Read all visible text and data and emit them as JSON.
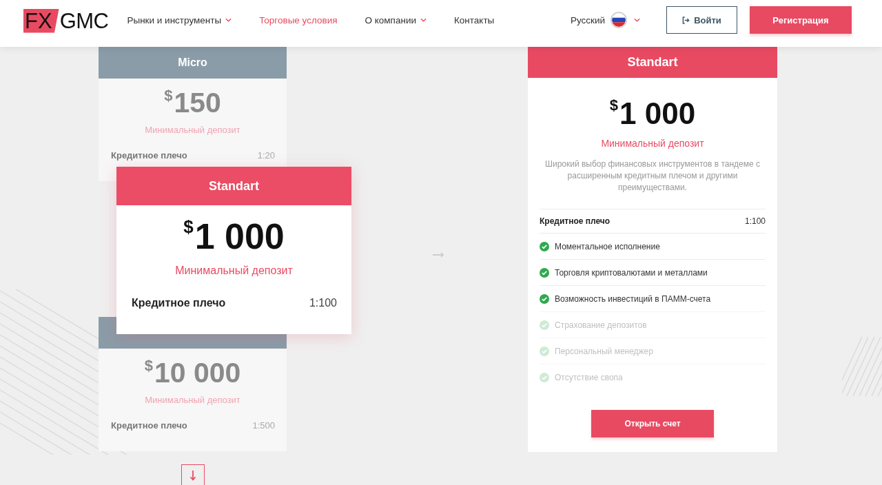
{
  "header": {
    "logo": {
      "highlight": "FX",
      "text": "GMC"
    },
    "nav": [
      {
        "label": "Рынки и инструменты",
        "dropdown": true,
        "selected": false
      },
      {
        "label": "Торговые условия",
        "dropdown": false,
        "selected": true
      },
      {
        "label": "О компании",
        "dropdown": true,
        "selected": false
      },
      {
        "label": "Контакты",
        "dropdown": false,
        "selected": false
      }
    ],
    "language": {
      "label": "Русский"
    },
    "login_button": {
      "label": "Войти"
    },
    "register_button": {
      "label": "Регистрация"
    }
  },
  "account_carousel": {
    "cards": [
      {
        "name": "Micro",
        "currency": "$",
        "price": "150",
        "deposit_label": "Минимальный депозит",
        "leverage_label": "Кредитное плечо",
        "leverage": "1:20",
        "selected": false
      },
      {
        "name": "Standart",
        "currency": "$",
        "price": "1 000",
        "deposit_label": "Минимальный депозит",
        "leverage_label": "Кредитное плечо",
        "leverage": "1:100",
        "selected": true
      },
      {
        "currency": "$",
        "price": "10 000",
        "deposit_label": "Минимальный депозит",
        "leverage_label": "Кредитное плечо",
        "leverage": "1:500",
        "selected": false
      }
    ]
  },
  "account_details": {
    "name": "Standart",
    "currency": "$",
    "price": "1 000",
    "deposit_label": "Минимальный депозит",
    "description": "Широкий выбор финансовых инструментов в тандеме с расширенным кредитным плечом и другими преимуществами.",
    "leverage_label": "Кредитное плечо",
    "leverage": "1:100",
    "features": [
      {
        "label": "Моментальное исполнение",
        "available": true
      },
      {
        "label": "Торговля криптовалютами и металлами",
        "available": true
      },
      {
        "label": "Возможность инвестиций в ПАММ-счета",
        "available": true
      },
      {
        "label": "Страхование депозитов",
        "available": false
      },
      {
        "label": "Персональный менеджер",
        "available": false
      },
      {
        "label": "Отсутствие свопа",
        "available": false
      }
    ],
    "button": {
      "label": "Открыть счет"
    }
  }
}
